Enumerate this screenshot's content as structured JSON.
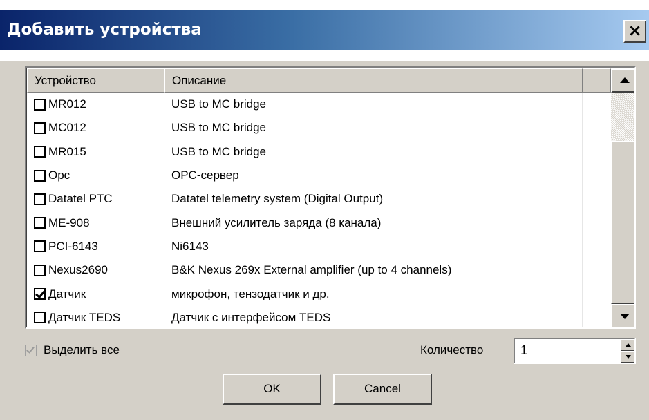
{
  "window": {
    "title": "Добавить устройства",
    "close_label": "×"
  },
  "table": {
    "columns": [
      "Устройство",
      "Описание"
    ],
    "rows": [
      {
        "device": "MR012",
        "description": "USB to MC bridge",
        "checked": false
      },
      {
        "device": "MC012",
        "description": "USB to MC bridge",
        "checked": false
      },
      {
        "device": "MR015",
        "description": "USB to MC bridge",
        "checked": false
      },
      {
        "device": "Opc",
        "description": "OPC-сервер",
        "checked": false
      },
      {
        "device": "Datatel PTC",
        "description": "Datatel telemetry system (Digital Output)",
        "checked": false
      },
      {
        "device": "ME-908",
        "description": "Внешний усилитель заряда (8 канала)",
        "checked": false
      },
      {
        "device": "PCI-6143",
        "description": "Ni6143",
        "checked": false
      },
      {
        "device": "Nexus2690",
        "description": "B&K Nexus 269x External amplifier (up to 4 channels)",
        "checked": false
      },
      {
        "device": "Датчик",
        "description": "микрофон, тензодатчик и др.",
        "checked": true
      },
      {
        "device": "Датчик TEDS",
        "description": "Датчик с интерфейсом TEDS",
        "checked": false
      }
    ]
  },
  "select_all": {
    "label": "Выделить все",
    "checked": true,
    "enabled": false
  },
  "quantity": {
    "label": "Количество",
    "value": "1"
  },
  "buttons": {
    "ok": "OK",
    "cancel": "Cancel"
  }
}
